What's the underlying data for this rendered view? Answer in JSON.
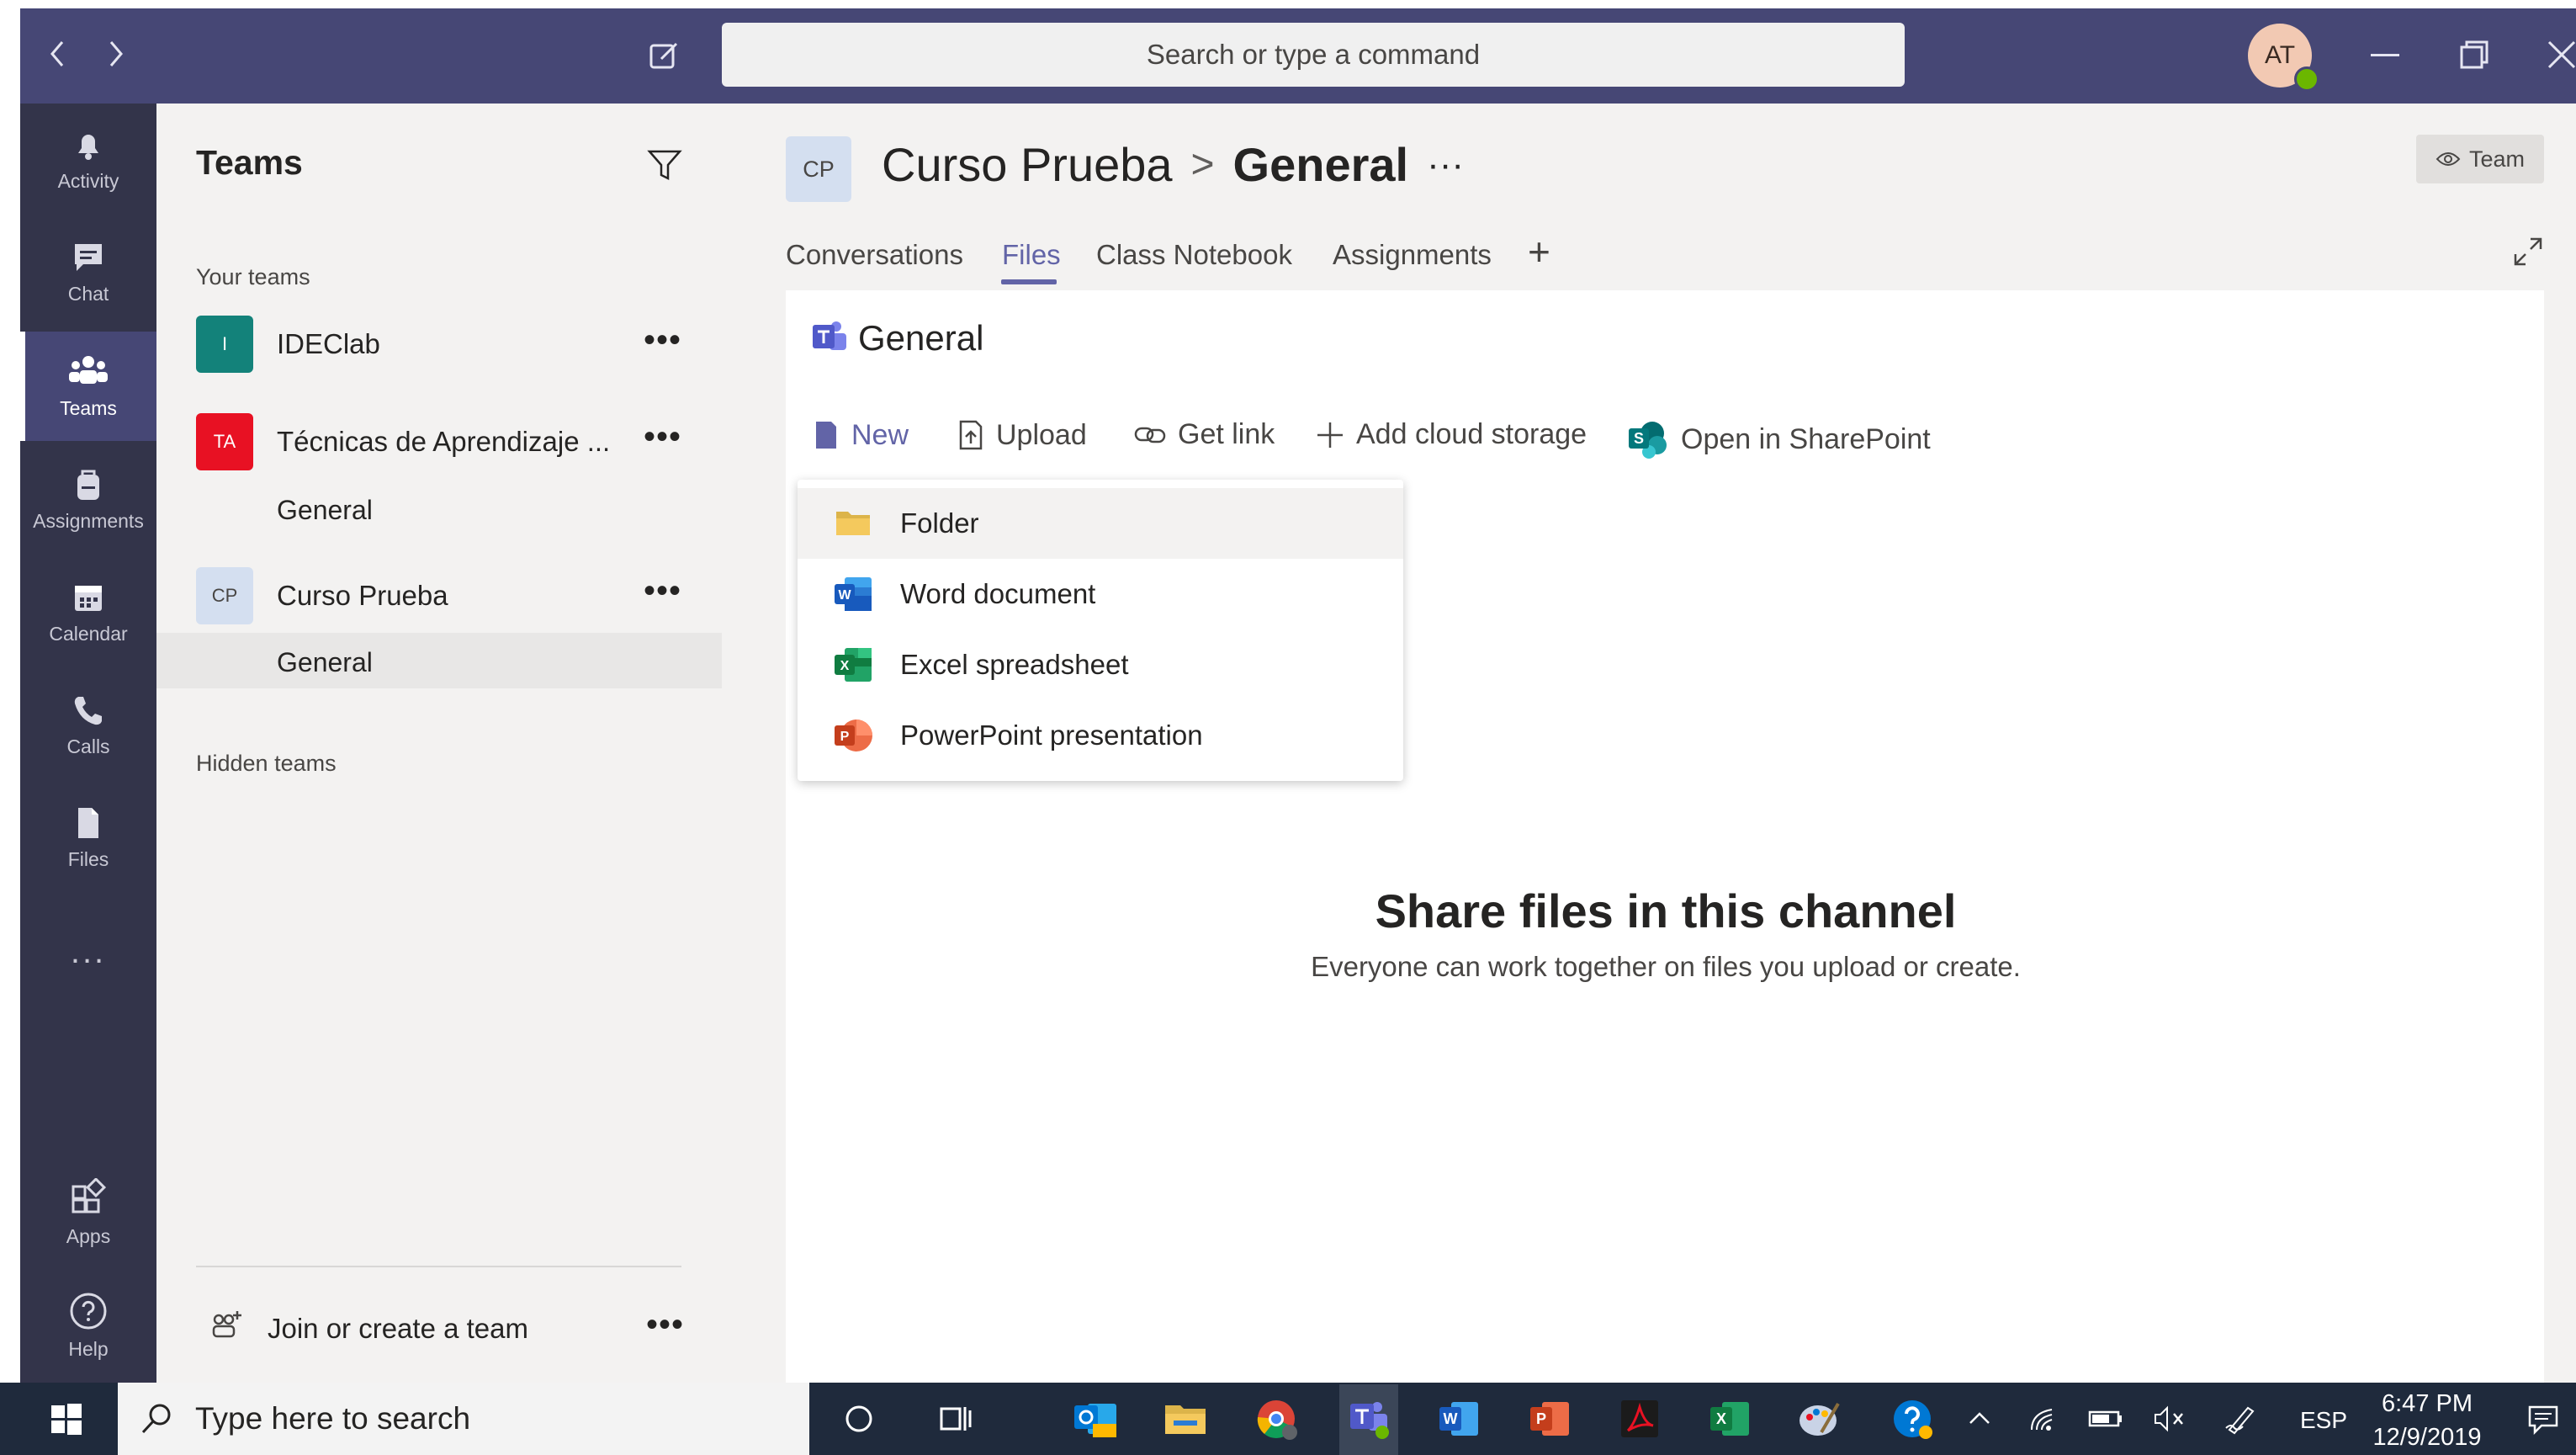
{
  "titlebar": {
    "search_placeholder": "Search or type a command",
    "avatar_initials": "AT",
    "colors": {
      "bar": "#464775",
      "status": "#6bb700"
    }
  },
  "rail": {
    "items": [
      {
        "label": "Activity",
        "icon": "bell-icon"
      },
      {
        "label": "Chat",
        "icon": "chat-icon"
      },
      {
        "label": "Teams",
        "icon": "teams-icon",
        "active": true
      },
      {
        "label": "Assignments",
        "icon": "backpack-icon"
      },
      {
        "label": "Calendar",
        "icon": "calendar-icon"
      },
      {
        "label": "Calls",
        "icon": "phone-icon"
      },
      {
        "label": "Files",
        "icon": "file-icon"
      }
    ],
    "more_label": "...",
    "bottom": [
      {
        "label": "Apps",
        "icon": "apps-icon"
      },
      {
        "label": "Help",
        "icon": "help-icon"
      }
    ]
  },
  "panel": {
    "title": "Teams",
    "your_teams_label": "Your teams",
    "teams": [
      {
        "initials": "I",
        "name": "IDEClab",
        "color": "#13827a"
      },
      {
        "initials": "TA",
        "name": "Técnicas de Aprendizaje ...",
        "color": "#e81123",
        "channel": "General"
      },
      {
        "initials": "CP",
        "name": "Curso Prueba",
        "color": "#d4dff0",
        "channel": "General"
      }
    ],
    "hidden_teams_label": "Hidden teams",
    "join_label": "Join or create a team"
  },
  "main": {
    "team_initials": "CP",
    "team_name": "Curso Prueba",
    "separator": ">",
    "channel_name": "General",
    "more": "···",
    "badge_label": "Team",
    "tabs": [
      "Conversations",
      "Files",
      "Class Notebook",
      "Assignments"
    ],
    "active_tab": "Files",
    "add_tab": "+",
    "files_heading": "General",
    "commands": {
      "new": "New",
      "upload": "Upload",
      "get_link": "Get link",
      "add_cloud": "Add cloud storage",
      "sharepoint": "Open in SharePoint"
    },
    "new_menu": [
      {
        "label": "Folder",
        "icon": "folder-icon"
      },
      {
        "label": "Word document",
        "icon": "word-icon"
      },
      {
        "label": "Excel spreadsheet",
        "icon": "excel-icon"
      },
      {
        "label": "PowerPoint presentation",
        "icon": "powerpoint-icon"
      }
    ],
    "empty_title": "Share files in this channel",
    "empty_subtitle": "Everyone can work together on files you upload or create.",
    "accent": "#6264a7"
  },
  "taskbar": {
    "search_placeholder": "Type here to search",
    "language": "ESP",
    "time": "6:47 PM",
    "date": "12/9/2019"
  }
}
